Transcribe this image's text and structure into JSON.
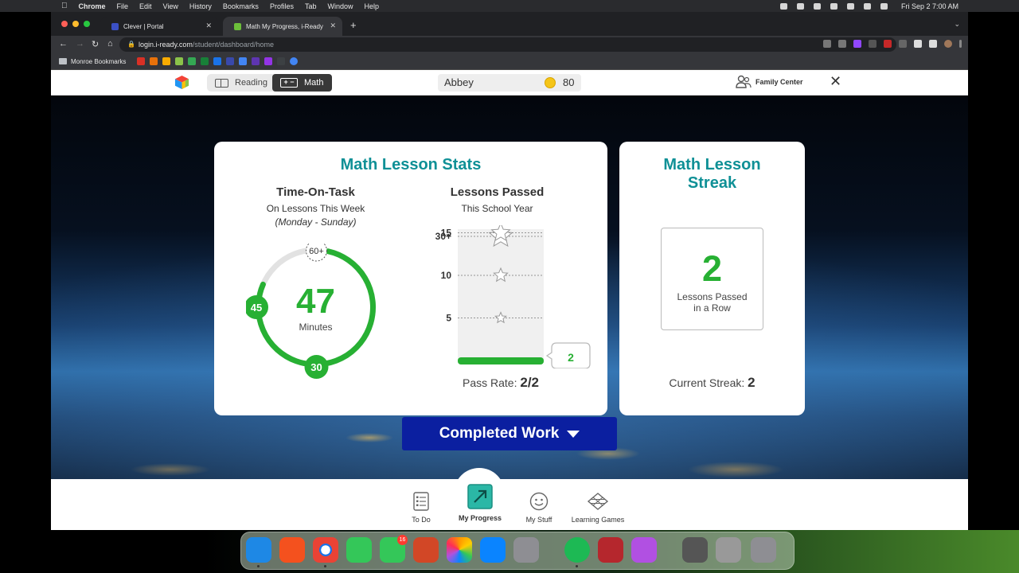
{
  "menubar": {
    "app": "Chrome",
    "items": [
      "File",
      "Edit",
      "View",
      "History",
      "Bookmarks",
      "Profiles",
      "Tab",
      "Window",
      "Help"
    ],
    "clock": "Fri Sep 2  7:00 AM"
  },
  "browser": {
    "tabs": [
      {
        "title": "Clever | Portal",
        "favicon_color": "#3b50c4"
      },
      {
        "title": "Math My Progress, i-Ready",
        "favicon_color": "#6cbf3a"
      }
    ],
    "url_host": "login.i-ready.com",
    "url_path": "/student/dashboard/home",
    "bookmarks_folder": "Monroe Bookmarks",
    "bookmark_colors": [
      "#d93025",
      "#e8710a",
      "#f9ab00",
      "#8bc34a",
      "#34a853",
      "#188038",
      "#1a73e8",
      "#3949ab",
      "#4285f4",
      "#5e35b1",
      "#9334e6",
      "#7e57c2",
      "#3c4043"
    ]
  },
  "header": {
    "subjects": {
      "reading": "Reading",
      "math": "Math"
    },
    "student_name": "Abbey",
    "coins": "80",
    "family_center": "Family Center"
  },
  "stats": {
    "title": "Math Lesson Stats",
    "time_on_task": {
      "heading": "Time-On-Task",
      "subtitle": "On Lessons This Week",
      "range": "(Monday - Sunday)",
      "minutes": "47",
      "unit": "Minutes",
      "marker_top": "60+",
      "marker_left": "45",
      "marker_bottom": "30",
      "progress_fraction": 0.78
    },
    "lessons_passed": {
      "heading": "Lessons Passed",
      "subtitle": "This School Year",
      "tick_labels": [
        "30+",
        "15",
        "10",
        "5"
      ],
      "tick_values": [
        30,
        15,
        10,
        5
      ],
      "passed_count": 2,
      "passed_label": "2",
      "pass_rate_label": "Pass Rate:",
      "pass_rate_value": "2/2"
    }
  },
  "streak": {
    "title_line1": "Math Lesson",
    "title_line2": "Streak",
    "count": "2",
    "box_line1": "Lessons Passed",
    "box_line2": "in a Row",
    "current_label": "Current Streak:",
    "current_value": "2"
  },
  "completed_work": "Completed Work",
  "bottom_nav": {
    "todo": "To Do",
    "progress": "My Progress",
    "stuff": "My Stuff",
    "games": "Learning Games"
  },
  "dock": {
    "messages_badge": "16",
    "app_colors": [
      "#1e88e5",
      "#f4511e",
      "#4caf50",
      "#34c759",
      "#34c759",
      "#d24726",
      "#ff9500",
      "#0a84ff",
      "#8e8e93",
      "#1db954",
      "#b5272d",
      "#b150e2",
      "#555555",
      "#8e8e93"
    ]
  }
}
